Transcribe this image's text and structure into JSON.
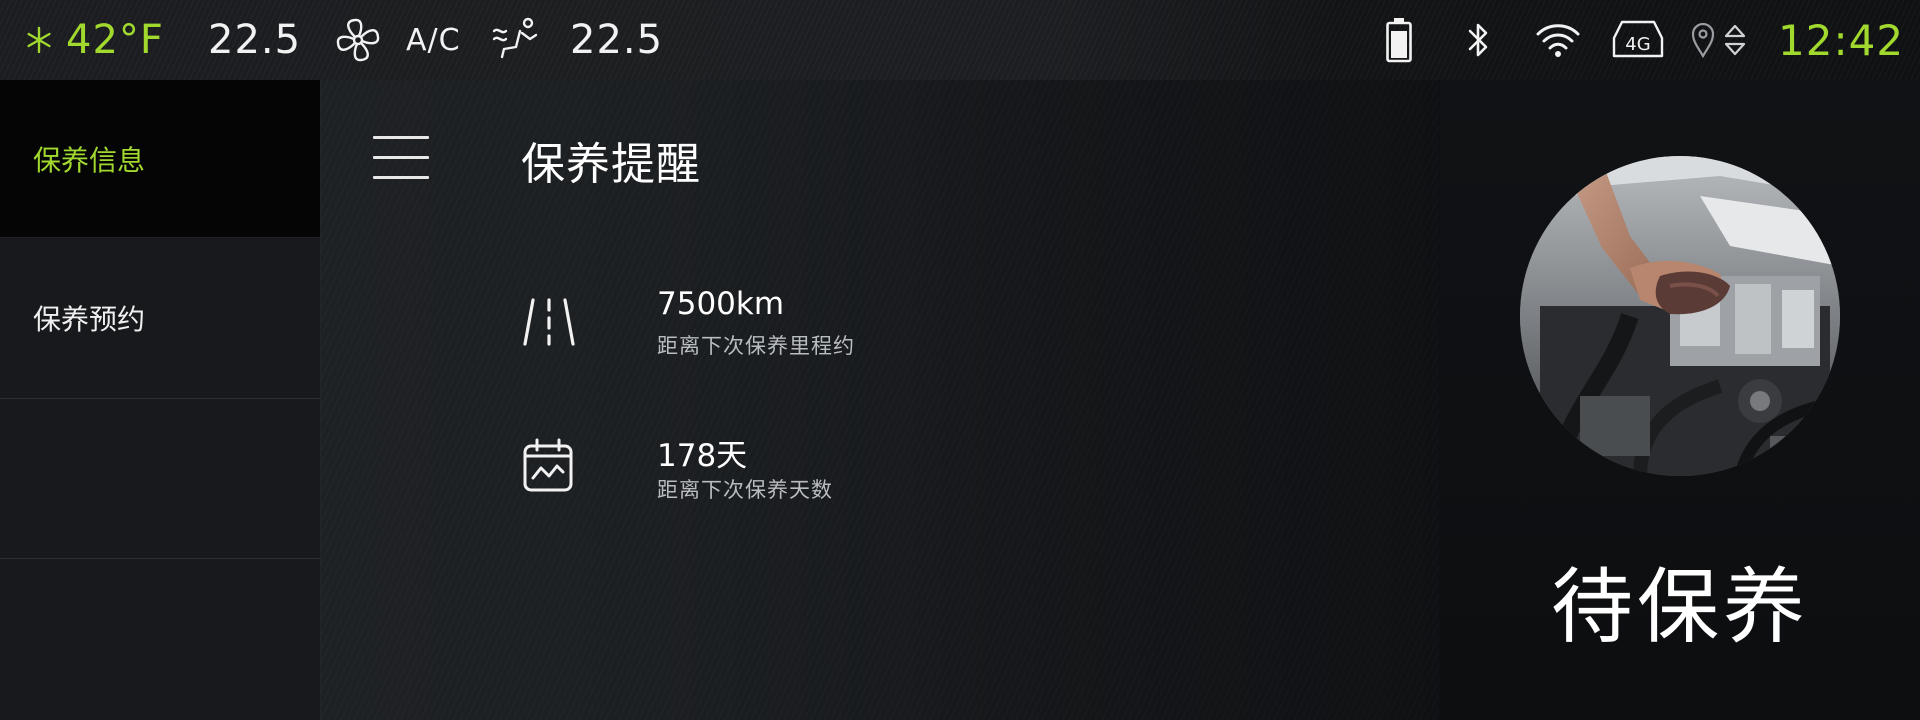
{
  "status_bar": {
    "outside_temp": "42°F",
    "left_temp": "22.5",
    "ac_label": "A/C",
    "right_temp": "22.5",
    "time": "12:42",
    "network_badge": "4G",
    "icons": {
      "snowflake": "snowflake-icon",
      "fan": "fan-icon",
      "seat_airflow": "seat-airflow-icon",
      "battery": "battery-icon",
      "bluetooth": "bluetooth-icon",
      "wifi": "wifi-icon",
      "cellular": "cellular-4g-icon",
      "location": "location-pin-icon",
      "arrows": "up-down-arrows-icon"
    },
    "colors": {
      "accent_green": "#a2d92e",
      "text_white": "#f2f2f2"
    }
  },
  "sidebar": {
    "items": [
      {
        "label": "保养信息",
        "active": true
      },
      {
        "label": "保养预约",
        "active": false
      },
      {
        "label": "",
        "active": false
      },
      {
        "label": "",
        "active": false
      }
    ]
  },
  "main": {
    "title": "保养提醒",
    "menu_icon": "hamburger-menu-icon",
    "rows": [
      {
        "icon": "road-icon",
        "value": "7500km",
        "label": "距离下次保养里程约"
      },
      {
        "icon": "calendar-icon",
        "value": "178天",
        "label": "距离下次保养天数"
      }
    ]
  },
  "right_panel": {
    "image_name": "engine-maintenance-photo",
    "status": "待保养"
  }
}
